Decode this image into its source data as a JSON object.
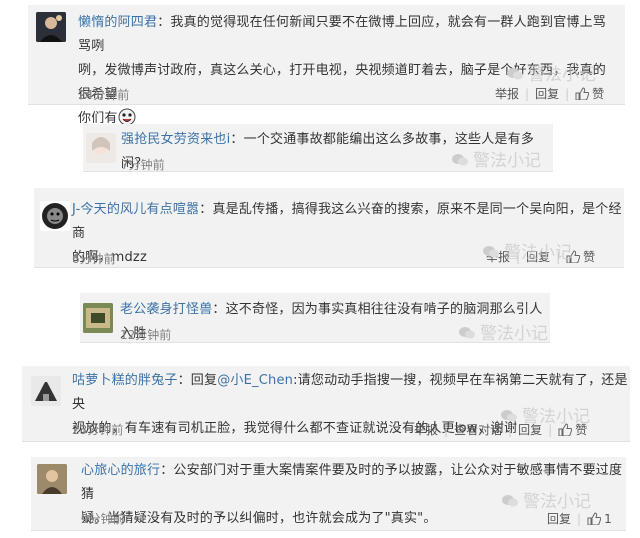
{
  "comments": [
    {
      "user": "懒惰的阿四君",
      "text_line1": "：我真的觉得现在任何新闻只要不在微博上回应，就会有一群人跑到官博上骂骂咧",
      "text_line2": "咧，发微博声讨政府，真这么关心，打开电视，央视频道盯着去，脑子是个好东西，我真的很希望",
      "text_line3": "你们有",
      "time": "24分钟前",
      "actions": [
        "举报",
        "回复",
        "赞"
      ]
    },
    {
      "user": "强抢民女劳资来也i",
      "text_line1": "：一个交通事故都能编出这么多故事，这些人是有多闲？",
      "time": "7分钟前"
    },
    {
      "user": "J-今天的风儿有点喧嚣",
      "text_line1": "：真是乱传播，搞得我这么兴奋的搜索，原来不是同一个吴向阳，是个经商",
      "text_line2": "的啊，mdzz",
      "time": "6分钟前",
      "actions": [
        "举报",
        "回复",
        "赞"
      ]
    },
    {
      "user": "老公袭身打怪兽",
      "text_line1": "：这不奇怪，因为事实真相往往没有啃子的脑洞那么引人入胜",
      "time": "12分钟前"
    },
    {
      "user": "咕萝卜糕的胖兔子",
      "reply_prefix": "：回复",
      "reply_to": "@小E_Chen",
      "text_line1": ":请您动动手指搜一搜，视频早在车祸第二天就有了，还是央",
      "text_line2": "视放的，有车速有司机正脸，我觉得什么都不查证就说没有的人更low，谢谢",
      "time": "23分钟前",
      "actions": [
        "举报",
        "查看对话",
        "回复",
        "赞"
      ]
    },
    {
      "user": "心旅心的旅行",
      "text_line1": "：公安部门对于重大案情案件要及时的予以披露，让公众对于敏感事情不要过度猜",
      "text_line2": "疑。当猜疑没有及时的予以纠偏时，也许就会成为了\"真实\"。",
      "time": "9分钟前",
      "actions": [
        "回复",
        "1"
      ]
    }
  ],
  "watermark": "警法小记",
  "colors": {
    "username": "#3a72a8",
    "card_bg": "#f2f2f2",
    "time": "#808080"
  }
}
